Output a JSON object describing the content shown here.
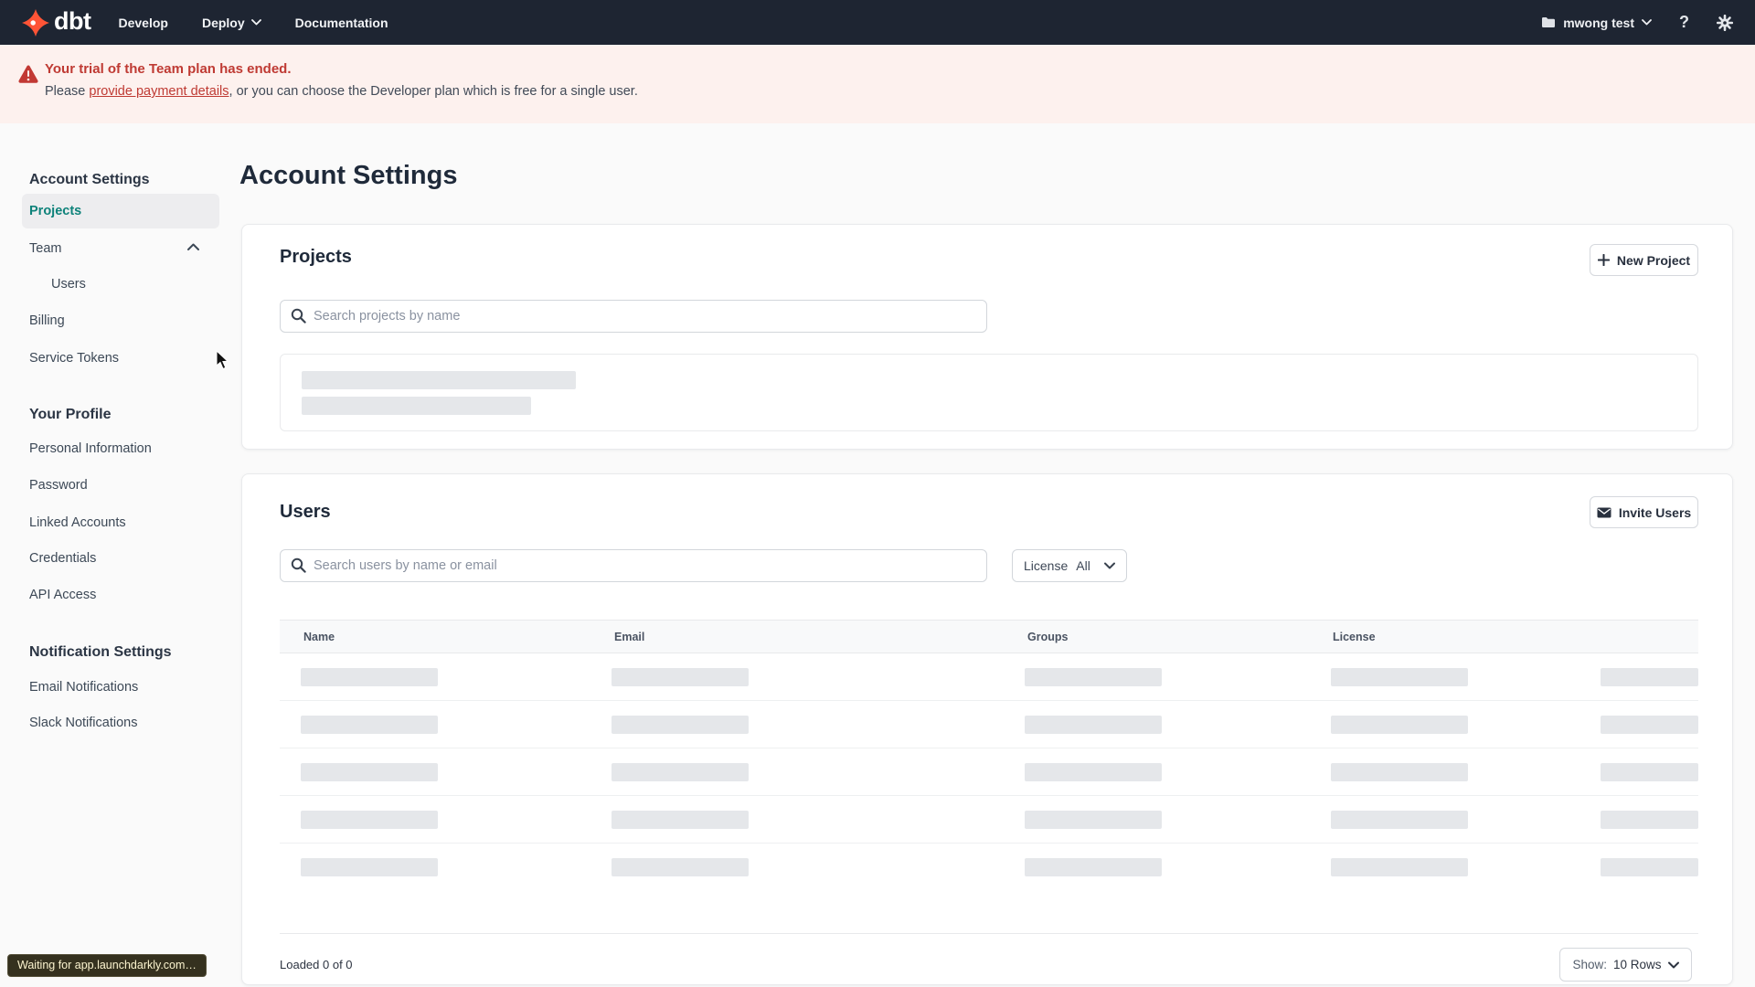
{
  "topnav": {
    "logo_text": "dbt",
    "items": [
      {
        "label": "Develop"
      },
      {
        "label": "Deploy"
      },
      {
        "label": "Documentation"
      }
    ],
    "account_label": "mwong test",
    "help_glyph": "?"
  },
  "banner": {
    "title": "Your trial of the Team plan has ended.",
    "body_prefix": "Please ",
    "link_text": "provide payment details",
    "body_suffix": ", or you can choose the Developer plan which is free for a single user."
  },
  "sidebar": {
    "sections": [
      {
        "heading": "Account Settings",
        "items": [
          {
            "label": "Projects"
          },
          {
            "label": "Team"
          },
          {
            "label": "Users"
          },
          {
            "label": "Billing"
          },
          {
            "label": "Service Tokens"
          }
        ]
      },
      {
        "heading": "Your Profile",
        "items": [
          {
            "label": "Personal Information"
          },
          {
            "label": "Password"
          },
          {
            "label": "Linked Accounts"
          },
          {
            "label": "Credentials"
          },
          {
            "label": "API Access"
          }
        ]
      },
      {
        "heading": "Notification Settings",
        "items": [
          {
            "label": "Email Notifications"
          },
          {
            "label": "Slack Notifications"
          }
        ]
      }
    ]
  },
  "main": {
    "title": "Account Settings"
  },
  "projects_card": {
    "title": "Projects",
    "new_button_label": "New Project",
    "search_placeholder": "Search projects by name"
  },
  "users_card": {
    "title": "Users",
    "invite_button_label": "Invite Users",
    "search_placeholder": "Search users by name or email",
    "license_filter_label": "License",
    "license_filter_value": "All",
    "table": {
      "columns": [
        "Name",
        "Email",
        "Groups",
        "License"
      ],
      "skeleton_row_count": 5
    },
    "footer": {
      "loaded_text": "Loaded 0 of 0",
      "show_label": "Show:",
      "show_value": "10 Rows"
    }
  },
  "status_tooltip": {
    "text": "Waiting for app.launchdarkly.com…"
  },
  "icons": {
    "logo": "dbt-flame-mark",
    "warning": "triangle-exclamation",
    "search": "magnifying-glass",
    "plus": "plus",
    "envelope": "envelope",
    "chevron_down": "chevron-down",
    "chevron_up": "chevron-up",
    "folder": "folder",
    "help": "question-mark",
    "gear": "gear",
    "cursor": "arrow-pointer"
  },
  "colors": {
    "nav_bg": "#1e2532",
    "brand_orange": "#ff5436",
    "accent_teal": "#0e827a",
    "banner_bg": "#fdf1ee",
    "banner_red": "#bf3a33",
    "skeleton": "#e5e7ea",
    "page_bg": "#fafafa"
  }
}
